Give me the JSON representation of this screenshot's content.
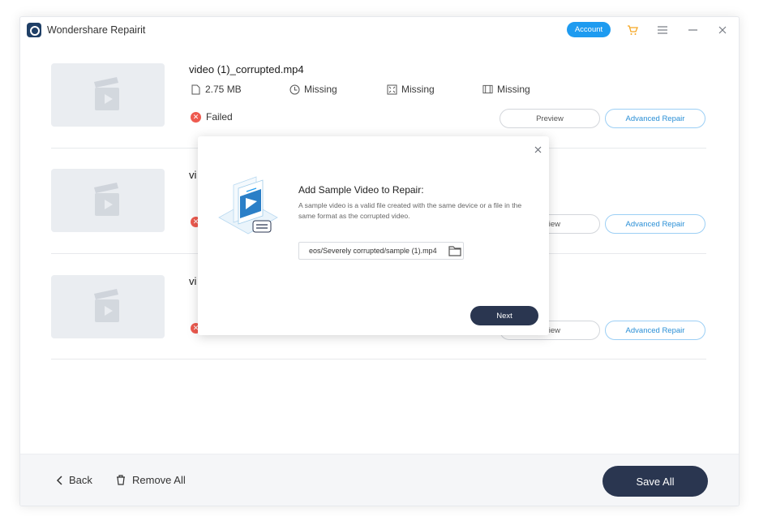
{
  "app": {
    "title": "Wondershare Repairit",
    "account_label": "Account"
  },
  "titlebar_icons": [
    "cart-icon",
    "menu-icon",
    "minimize-icon",
    "close-icon"
  ],
  "files": [
    {
      "name": "video (1)_corrupted.mp4",
      "size": "2.75  MB",
      "duration": "Missing",
      "resolution": "Missing",
      "codec": "Missing",
      "status": "Failed",
      "preview_label": "Preview",
      "advanced_label": "Advanced Repair"
    },
    {
      "name": "vi",
      "preview_label": "Preview",
      "advanced_label": "Advanced Repair",
      "preview_visible": "iew"
    },
    {
      "name": "vi",
      "preview_label": "Preview",
      "advanced_label": "Advanced Repair",
      "preview_visible": "iew"
    }
  ],
  "footer": {
    "back_label": "Back",
    "remove_all_label": "Remove All",
    "save_all_label": "Save All"
  },
  "modal": {
    "title": "Add Sample Video to Repair:",
    "description": "A sample video is a valid file created with the same device or a file in the same format as the corrupted video.",
    "path_value": "eos/Severely corrupted/sample (1).mp4",
    "next_label": "Next"
  },
  "colors": {
    "accent_blue": "#1e9bf0",
    "dark_button": "#2a3650",
    "failed_red": "#ee5a4f",
    "cart_orange": "#f5a623"
  }
}
